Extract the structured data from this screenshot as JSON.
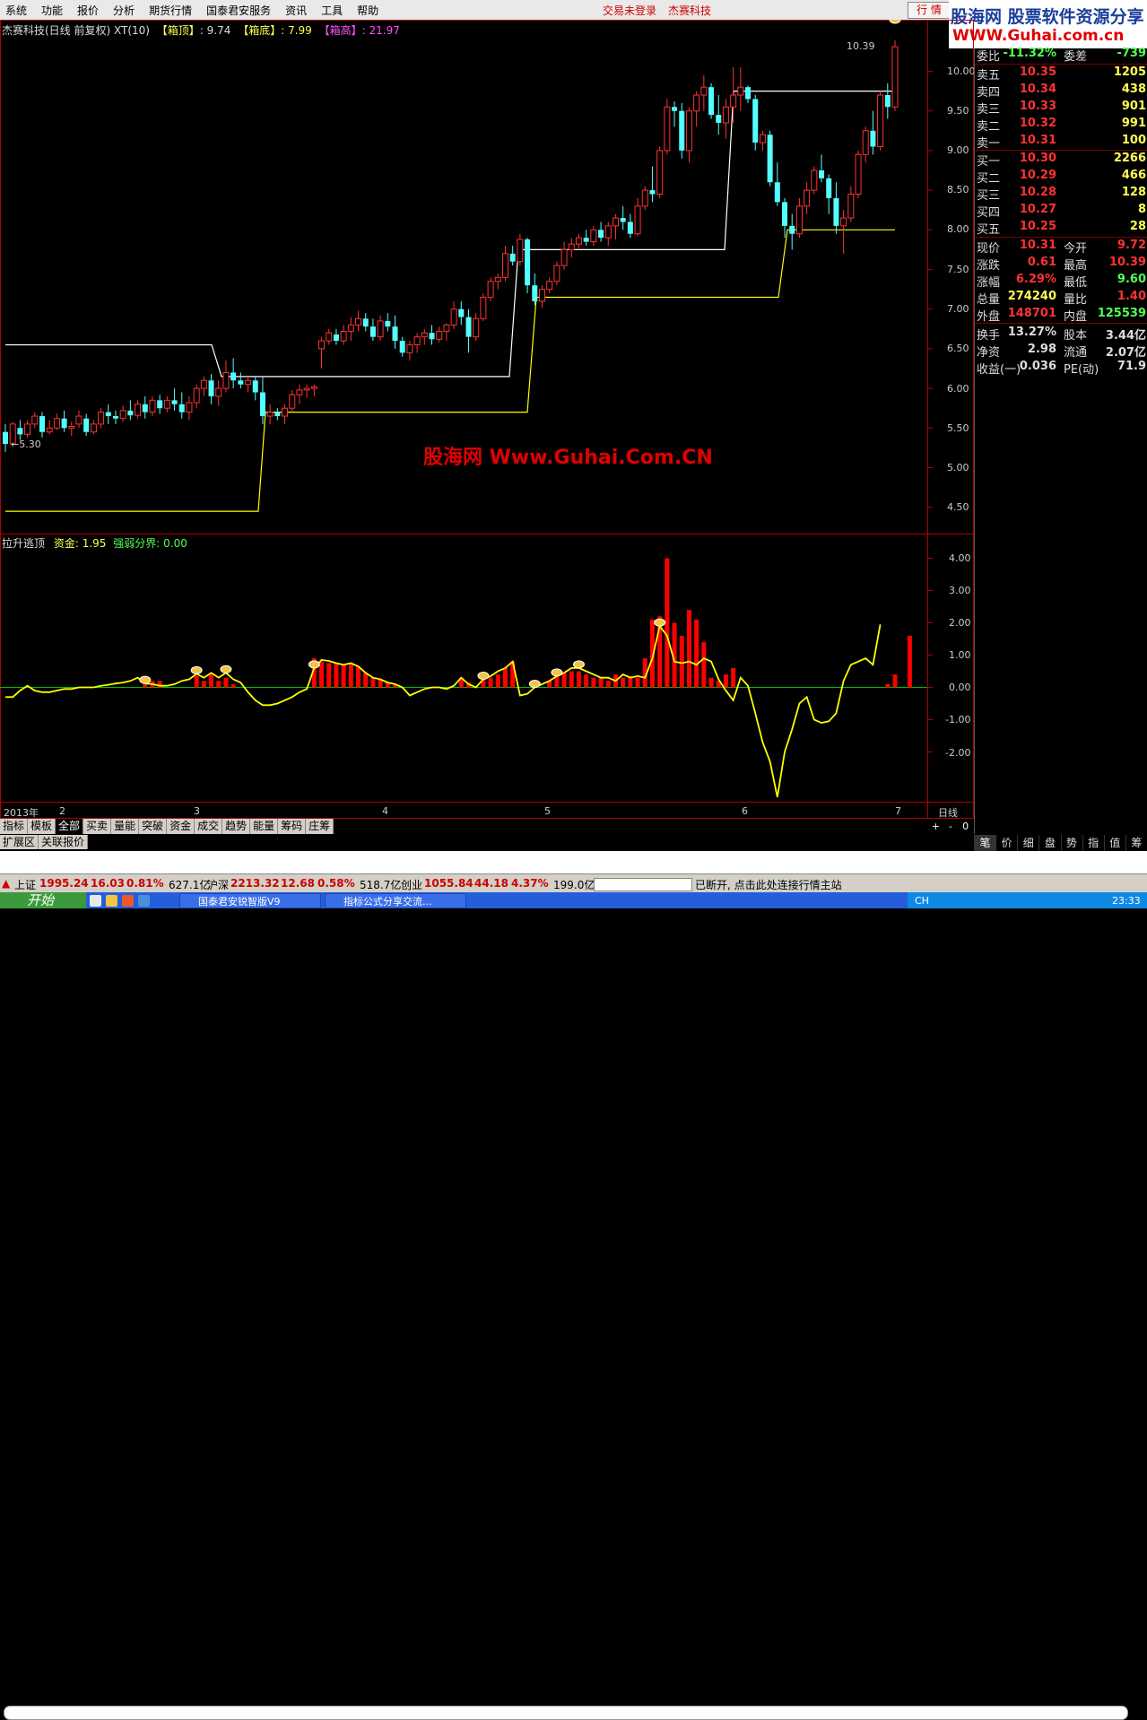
{
  "menu": {
    "items": [
      "系统",
      "功能",
      "报价",
      "分析",
      "期货行情",
      "国泰君安服务",
      "资讯",
      "工具",
      "帮助"
    ],
    "login_status": "交易未登录",
    "company": "杰赛科技",
    "quote_button": "行 情"
  },
  "logo": {
    "line1": "股海网 股票软件资源分享",
    "line2": "WWW.Guhai.com.cn"
  },
  "main_chart": {
    "title": "杰赛科技(日线 前复权) XT(10)",
    "box_top_label": "【箱顶】",
    "box_top_value": ": 9.74",
    "box_bottom_label": "【箱底】",
    "box_bottom_value": ": 7.99",
    "box_high_label": "【箱高】",
    "box_high_value": ": 21.97",
    "high_marker": "10.39",
    "low_marker": "←5.30",
    "watermark": "股海网 Www.Guhai.Com.CN",
    "y_ticks": [
      "10.00",
      "9.50",
      "9.00",
      "8.50",
      "8.00",
      "7.50",
      "7.00",
      "6.50",
      "6.00",
      "5.50",
      "5.00",
      "4.50"
    ],
    "x_labels": [
      "2013年",
      "2",
      "3",
      "4",
      "5",
      "6",
      "7"
    ],
    "x_right_label": "日线"
  },
  "indicator": {
    "name": "拉升逃顶",
    "fund_label": "资金",
    "fund_value": ": 1.95",
    "boundary_label": "强弱分界",
    "boundary_value": ": 0.00",
    "y_ticks": [
      "4.00",
      "3.00",
      "2.00",
      "1.00",
      "0.00",
      "-1.00",
      "-2.00"
    ]
  },
  "colors": {
    "up": "#ff3232",
    "down": "#54ffff",
    "box_upper": "#ffffff",
    "box_lower": "#ffff00",
    "fund_line": "#ffff00",
    "boundary": "#00c000",
    "bar": "#ff0000"
  },
  "chart_data": [
    {
      "type": "candlestick",
      "title": "杰赛科技(日线 前复权) XT(10)",
      "y_range": [
        4.3,
        10.5
      ],
      "candles": [
        [
          5.45,
          5.55,
          5.2,
          5.3
        ],
        [
          5.3,
          5.58,
          5.3,
          5.55
        ],
        [
          5.5,
          5.6,
          5.35,
          5.42
        ],
        [
          5.42,
          5.6,
          5.38,
          5.55
        ],
        [
          5.55,
          5.7,
          5.5,
          5.65
        ],
        [
          5.65,
          5.7,
          5.38,
          5.45
        ],
        [
          5.45,
          5.6,
          5.42,
          5.5
        ],
        [
          5.5,
          5.68,
          5.48,
          5.62
        ],
        [
          5.62,
          5.72,
          5.45,
          5.5
        ],
        [
          5.5,
          5.58,
          5.4,
          5.52
        ],
        [
          5.55,
          5.72,
          5.5,
          5.65
        ],
        [
          5.62,
          5.68,
          5.4,
          5.45
        ],
        [
          5.45,
          5.6,
          5.42,
          5.55
        ],
        [
          5.55,
          5.75,
          5.5,
          5.7
        ],
        [
          5.7,
          5.8,
          5.55,
          5.65
        ],
        [
          5.65,
          5.72,
          5.55,
          5.62
        ],
        [
          5.62,
          5.78,
          5.58,
          5.72
        ],
        [
          5.72,
          5.85,
          5.6,
          5.66
        ],
        [
          5.66,
          5.85,
          5.62,
          5.8
        ],
        [
          5.8,
          5.9,
          5.62,
          5.7
        ],
        [
          5.7,
          5.9,
          5.65,
          5.85
        ],
        [
          5.85,
          5.92,
          5.68,
          5.75
        ],
        [
          5.75,
          5.9,
          5.7,
          5.85
        ],
        [
          5.85,
          6.0,
          5.72,
          5.8
        ],
        [
          5.8,
          5.95,
          5.62,
          5.7
        ],
        [
          5.7,
          5.9,
          5.6,
          5.82
        ],
        [
          5.82,
          6.05,
          5.75,
          6.0
        ],
        [
          6.0,
          6.15,
          5.9,
          6.1
        ],
        [
          6.1,
          6.18,
          5.8,
          5.9
        ],
        [
          5.9,
          6.1,
          5.78,
          6.0
        ],
        [
          6.0,
          6.35,
          5.95,
          6.2
        ],
        [
          6.2,
          6.38,
          6.0,
          6.1
        ],
        [
          6.1,
          6.2,
          6.0,
          6.05
        ],
        [
          6.05,
          6.15,
          5.95,
          6.1
        ],
        [
          6.1,
          6.15,
          5.85,
          5.95
        ],
        [
          5.95,
          6.15,
          5.55,
          5.65
        ],
        [
          5.65,
          5.8,
          5.55,
          5.7
        ],
        [
          5.7,
          5.75,
          5.6,
          5.65
        ],
        [
          5.65,
          5.8,
          5.55,
          5.75
        ],
        [
          5.75,
          5.98,
          5.7,
          5.92
        ],
        [
          5.92,
          6.05,
          5.8,
          5.98
        ],
        [
          5.98,
          6.05,
          5.88,
          6.0
        ],
        [
          6.0,
          6.05,
          5.9,
          6.02
        ],
        [
          6.5,
          6.65,
          6.25,
          6.6
        ],
        [
          6.6,
          6.75,
          6.55,
          6.7
        ],
        [
          6.68,
          6.75,
          6.55,
          6.6
        ],
        [
          6.6,
          6.8,
          6.55,
          6.72
        ],
        [
          6.72,
          6.9,
          6.6,
          6.8
        ],
        [
          6.8,
          6.98,
          6.72,
          6.88
        ],
        [
          6.88,
          6.95,
          6.72,
          6.78
        ],
        [
          6.78,
          6.88,
          6.6,
          6.65
        ],
        [
          6.65,
          6.92,
          6.6,
          6.85
        ],
        [
          6.85,
          6.95,
          6.72,
          6.78
        ],
        [
          6.78,
          6.92,
          6.5,
          6.6
        ],
        [
          6.6,
          6.65,
          6.4,
          6.45
        ],
        [
          6.45,
          6.6,
          6.35,
          6.55
        ],
        [
          6.55,
          6.7,
          6.45,
          6.65
        ],
        [
          6.65,
          6.75,
          6.55,
          6.7
        ],
        [
          6.7,
          6.8,
          6.55,
          6.62
        ],
        [
          6.62,
          6.78,
          6.58,
          6.72
        ],
        [
          6.72,
          6.82,
          6.6,
          6.8
        ],
        [
          6.8,
          7.1,
          6.75,
          7.0
        ],
        [
          7.0,
          7.1,
          6.8,
          6.9
        ],
        [
          6.9,
          7.0,
          6.45,
          6.65
        ],
        [
          6.65,
          6.95,
          6.6,
          6.88
        ],
        [
          6.88,
          7.2,
          6.85,
          7.15
        ],
        [
          7.15,
          7.4,
          7.1,
          7.35
        ],
        [
          7.35,
          7.45,
          7.25,
          7.4
        ],
        [
          7.4,
          7.8,
          7.35,
          7.7
        ],
        [
          7.7,
          7.8,
          7.55,
          7.6
        ],
        [
          7.6,
          7.95,
          7.55,
          7.88
        ],
        [
          7.88,
          7.9,
          7.2,
          7.3
        ],
        [
          7.3,
          7.45,
          7.05,
          7.1
        ],
        [
          7.1,
          7.3,
          7.02,
          7.25
        ],
        [
          7.25,
          7.4,
          7.2,
          7.35
        ],
        [
          7.35,
          7.6,
          7.3,
          7.55
        ],
        [
          7.55,
          7.85,
          7.5,
          7.75
        ],
        [
          7.75,
          7.9,
          7.65,
          7.82
        ],
        [
          7.82,
          7.95,
          7.75,
          7.9
        ],
        [
          7.9,
          8.0,
          7.8,
          7.85
        ],
        [
          7.85,
          8.05,
          7.8,
          8.0
        ],
        [
          8.0,
          8.1,
          7.85,
          7.9
        ],
        [
          7.9,
          8.1,
          7.8,
          8.05
        ],
        [
          8.05,
          8.2,
          7.88,
          8.15
        ],
        [
          8.15,
          8.3,
          8.0,
          8.1
        ],
        [
          8.1,
          8.2,
          7.9,
          7.95
        ],
        [
          7.95,
          8.4,
          7.92,
          8.3
        ],
        [
          8.3,
          8.55,
          8.25,
          8.5
        ],
        [
          8.5,
          8.8,
          8.35,
          8.45
        ],
        [
          8.45,
          9.05,
          8.4,
          9.0
        ],
        [
          9.0,
          9.65,
          8.95,
          9.55
        ],
        [
          9.55,
          9.62,
          9.3,
          9.5
        ],
        [
          9.5,
          9.6,
          8.9,
          9.0
        ],
        [
          9.0,
          9.55,
          8.85,
          9.5
        ],
        [
          9.5,
          9.75,
          9.3,
          9.7
        ],
        [
          9.7,
          9.95,
          9.5,
          9.8
        ],
        [
          9.8,
          9.85,
          9.4,
          9.45
        ],
        [
          9.45,
          9.7,
          9.2,
          9.35
        ],
        [
          9.35,
          9.65,
          9.15,
          9.55
        ],
        [
          9.55,
          10.05,
          9.35,
          9.7
        ],
        [
          9.7,
          10.05,
          9.5,
          9.8
        ],
        [
          9.8,
          9.82,
          9.6,
          9.65
        ],
        [
          9.65,
          9.7,
          9.0,
          9.1
        ],
        [
          9.1,
          9.25,
          9.0,
          9.2
        ],
        [
          9.2,
          9.25,
          8.55,
          8.6
        ],
        [
          8.6,
          8.85,
          8.3,
          8.35
        ],
        [
          8.35,
          8.4,
          7.9,
          8.05
        ],
        [
          8.05,
          8.2,
          7.75,
          7.95
        ],
        [
          7.95,
          8.4,
          7.9,
          8.3
        ],
        [
          8.3,
          8.6,
          8.2,
          8.5
        ],
        [
          8.5,
          8.8,
          8.45,
          8.75
        ],
        [
          8.75,
          8.95,
          8.6,
          8.65
        ],
        [
          8.65,
          8.7,
          8.2,
          8.4
        ],
        [
          8.4,
          8.6,
          7.95,
          8.05
        ],
        [
          8.05,
          8.25,
          7.7,
          8.15
        ],
        [
          8.15,
          8.55,
          8.1,
          8.45
        ],
        [
          8.45,
          9.0,
          8.4,
          8.95
        ],
        [
          8.95,
          9.3,
          8.85,
          9.25
        ],
        [
          9.25,
          9.5,
          8.95,
          9.05
        ],
        [
          9.05,
          9.75,
          9.0,
          9.7
        ],
        [
          9.7,
          9.85,
          9.4,
          9.55
        ],
        [
          9.55,
          10.39,
          9.5,
          10.31
        ]
      ],
      "box_upper_line": "white stair line (box top 9.74)",
      "box_lower_line": "yellow stair line (box bottom 7.99)"
    },
    {
      "type": "bar+line",
      "title": "拉升逃顶",
      "y_range": [
        -2.8,
        4.4
      ],
      "fund_line": [
        -0.3,
        -0.3,
        -0.1,
        0.05,
        -0.1,
        -0.15,
        -0.15,
        -0.1,
        -0.05,
        -0.05,
        0.0,
        0.0,
        0.0,
        0.05,
        0.08,
        0.12,
        0.15,
        0.2,
        0.3,
        0.12,
        0.1,
        0.05,
        0.05,
        0.1,
        0.2,
        0.25,
        0.42,
        0.3,
        0.45,
        0.3,
        0.45,
        0.25,
        0.15,
        -0.15,
        -0.4,
        -0.55,
        -0.55,
        -0.5,
        -0.4,
        -0.3,
        -0.15,
        -0.05,
        0.6,
        0.85,
        0.82,
        0.75,
        0.7,
        0.75,
        0.65,
        0.45,
        0.3,
        0.25,
        0.15,
        0.1,
        0.0,
        -0.25,
        -0.15,
        -0.05,
        0.0,
        0.0,
        -0.05,
        0.05,
        0.3,
        0.1,
        0.0,
        0.25,
        0.35,
        0.5,
        0.6,
        0.8,
        -0.25,
        -0.2,
        0.0,
        0.1,
        0.2,
        0.35,
        0.45,
        0.6,
        0.6,
        0.5,
        0.4,
        0.3,
        0.3,
        0.2,
        0.4,
        0.3,
        0.35,
        0.3,
        0.9,
        1.9,
        1.6,
        0.8,
        0.75,
        0.8,
        0.7,
        0.9,
        0.8,
        0.25,
        -0.1,
        -0.4,
        0.3,
        0.05,
        -0.8,
        -1.7,
        -2.3,
        -3.4,
        -2.0,
        -1.3,
        -0.5,
        -0.3,
        -1.0,
        -1.1,
        -1.05,
        -0.8,
        0.2,
        0.7,
        0.8,
        0.9,
        0.7,
        1.95
      ],
      "bars": [
        0,
        0,
        0,
        0,
        0,
        0,
        0,
        0,
        0,
        0,
        0,
        0,
        0,
        0,
        0,
        0,
        0,
        0,
        0,
        0.3,
        0.2,
        0.2,
        0,
        0,
        0,
        0,
        0.35,
        0.2,
        0.4,
        0.2,
        0.3,
        0.1,
        0,
        0,
        0,
        0,
        0,
        0,
        0,
        0,
        0,
        0,
        0.9,
        0.8,
        0.75,
        0.75,
        0.7,
        0.75,
        0.65,
        0.45,
        0.3,
        0.25,
        0.15,
        0.1,
        0,
        0,
        0,
        0,
        0,
        0,
        0,
        0,
        0.3,
        0.15,
        0,
        0.25,
        0.3,
        0.4,
        0.6,
        0.8,
        0,
        0,
        0,
        0,
        0.2,
        0.35,
        0.45,
        0.5,
        0.5,
        0.4,
        0.3,
        0.3,
        0.2,
        0.4,
        0.3,
        0.35,
        0.3,
        0.9,
        2.1,
        2.2,
        4.0,
        2.0,
        1.6,
        2.4,
        2.1,
        1.4,
        0.3,
        0.2,
        0.4,
        0.6,
        0,
        0,
        0,
        0,
        0,
        0,
        0,
        0,
        0,
        0,
        0,
        0,
        0,
        0,
        0,
        0,
        0,
        0,
        0,
        0,
        0.1,
        0.4,
        0,
        1.6,
        0,
        0
      ],
      "markers": [
        19,
        26,
        30,
        42,
        65,
        72,
        75,
        78,
        89,
        121
      ]
    }
  ],
  "order_book": {
    "header": {
      "ratio_label": "委比",
      "ratio_value": "-11.32%",
      "diff_label": "委差",
      "diff_value": "-739"
    },
    "asks": [
      {
        "label": "卖五",
        "price": "10.35",
        "vol": "1205"
      },
      {
        "label": "卖四",
        "price": "10.34",
        "vol": "438"
      },
      {
        "label": "卖三",
        "price": "10.33",
        "vol": "901"
      },
      {
        "label": "卖二",
        "price": "10.32",
        "vol": "991"
      },
      {
        "label": "卖一",
        "price": "10.31",
        "vol": "100"
      }
    ],
    "bids": [
      {
        "label": "买一",
        "price": "10.30",
        "vol": "2266"
      },
      {
        "label": "买二",
        "price": "10.29",
        "vol": "466"
      },
      {
        "label": "买三",
        "price": "10.28",
        "vol": "128"
      },
      {
        "label": "买四",
        "price": "10.27",
        "vol": "8"
      },
      {
        "label": "买五",
        "price": "10.25",
        "vol": "28"
      }
    ]
  },
  "stats": [
    {
      "l1": "现价",
      "v1": "10.31",
      "c1": "#ff3232",
      "l2": "今开",
      "v2": "9.72",
      "c2": "#ff3232"
    },
    {
      "l1": "涨跌",
      "v1": "0.61",
      "c1": "#ff3232",
      "l2": "最高",
      "v2": "10.39",
      "c2": "#ff3232"
    },
    {
      "l1": "涨幅",
      "v1": "6.29%",
      "c1": "#ff3232",
      "l2": "最低",
      "v2": "9.60",
      "c2": "#54ff54"
    },
    {
      "l1": "总量",
      "v1": "274240",
      "c1": "#ffff54",
      "l2": "量比",
      "v2": "1.40",
      "c2": "#ff3232"
    },
    {
      "l1": "外盘",
      "v1": "148701",
      "c1": "#ff3232",
      "l2": "内盘",
      "v2": "125539",
      "c2": "#54ff54"
    },
    {
      "l1": "换手",
      "v1": "13.27%",
      "c1": "#dddddd",
      "l2": "股本",
      "v2": "3.44亿",
      "c2": "#dddddd"
    },
    {
      "l1": "净资",
      "v1": "2.98",
      "c1": "#dddddd",
      "l2": "流通",
      "v2": "2.07亿",
      "c2": "#dddddd"
    },
    {
      "l1": "收益(一)",
      "v1": "0.036",
      "c1": "#dddddd",
      "l2": "PE(动)",
      "v2": "71.9",
      "c2": "#dddddd"
    }
  ],
  "bottom_tabs": [
    "指标",
    "模板",
    "全部",
    "买卖",
    "量能",
    "突破",
    "资金",
    "成交",
    "趋势",
    "能量",
    "筹码",
    "庄筹"
  ],
  "bottom_tabs2": [
    "扩展区",
    "关联报价"
  ],
  "page_ctrl": [
    "+",
    "-",
    "0"
  ],
  "right_tabs": [
    "笔",
    "价",
    "细",
    "盘",
    "势",
    "指",
    "值",
    "筹"
  ],
  "status": {
    "sh_label": "上证",
    "sh_val": "1995.24",
    "sh_chg": "16.03",
    "sh_pct": "0.81%",
    "sh_amt": "627.1亿",
    "sz_label": "沪深",
    "sz_val": "2213.32",
    "sz_chg": "12.68",
    "sz_pct": "0.58%",
    "sz_amt": "518.7亿",
    "cy_label": "创业",
    "cy_val": "1055.84",
    "cy_chg": "44.18",
    "cy_pct": "4.37%",
    "cy_amt": "199.0亿",
    "msg": "已断开, 点击此处连接行情主站"
  },
  "taskbar": {
    "start": "开始",
    "win1": "国泰君安锐智版V9",
    "win2": "指标公式分享交流...",
    "lang": "CH",
    "time": "23:33"
  }
}
